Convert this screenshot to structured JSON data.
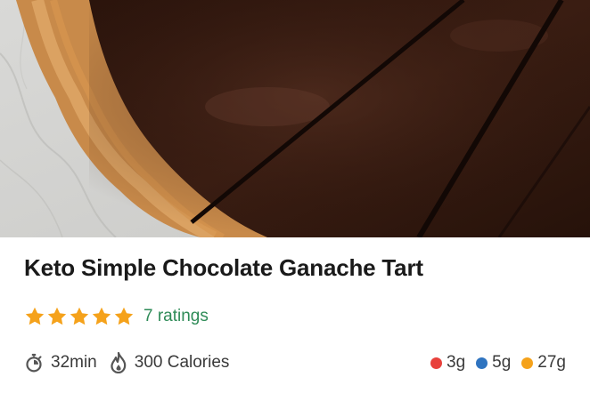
{
  "recipe": {
    "title": "Keto Simple Chocolate Ganache Tart",
    "rating_stars": 5,
    "ratings_text": "7 ratings",
    "time": "32min",
    "calories": "300 Calories"
  },
  "macros": [
    {
      "label": "3g",
      "color": "#e8413c"
    },
    {
      "label": "5g",
      "color": "#2f74c0"
    },
    {
      "label": "27g",
      "color": "#f5a21b"
    }
  ],
  "colors": {
    "star": "#f5a21b",
    "link": "#2e8b57"
  },
  "icons": {
    "time": "stopwatch-icon",
    "calories": "flame-icon",
    "rating": "star-icon"
  }
}
